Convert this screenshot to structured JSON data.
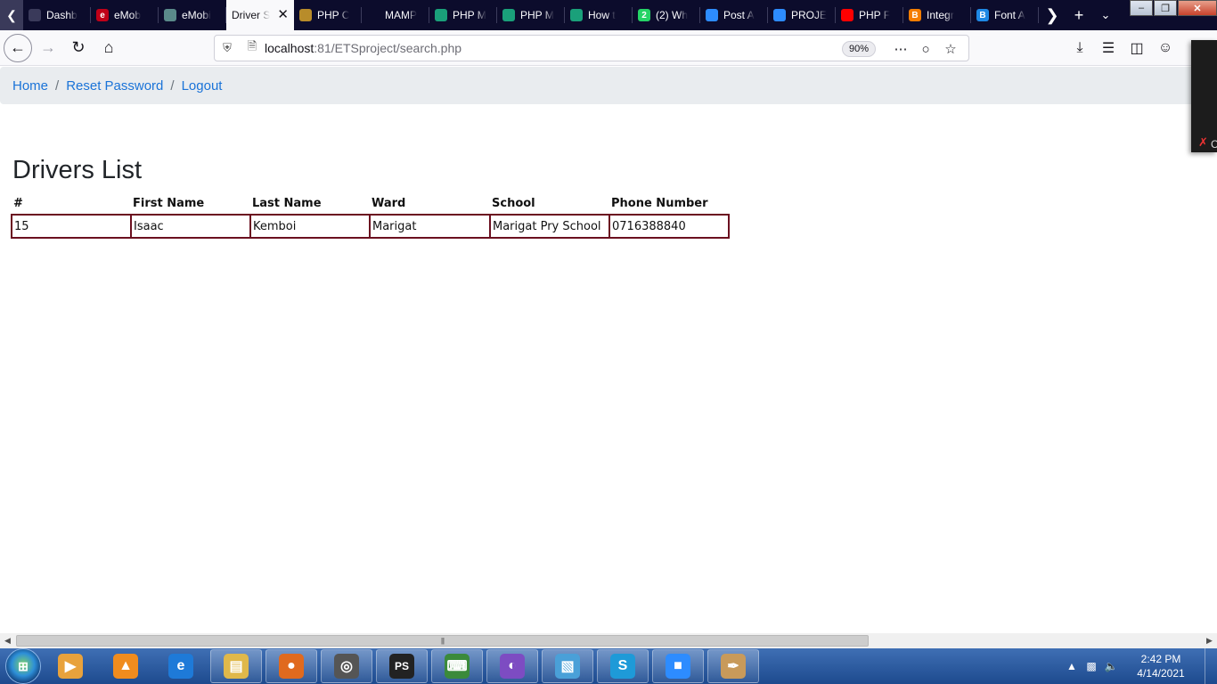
{
  "browser": {
    "tabs": [
      {
        "label": "Dashb",
        "icon": "dashboard-icon",
        "color": "#3a3a5a",
        "glyph": ""
      },
      {
        "label": "eMob",
        "icon": "emobilis-icon",
        "color": "#c00018",
        "glyph": "e"
      },
      {
        "label": "eMobi",
        "icon": "emobilis-alt-icon",
        "color": "#5a8a8a",
        "glyph": ""
      },
      {
        "label": "Driver S",
        "icon": "page-icon",
        "color": "#f9f9fb",
        "glyph": "",
        "active": true
      },
      {
        "label": "PHP C",
        "icon": "php-icon",
        "color": "#b88c2a",
        "glyph": ""
      },
      {
        "label": "MAMP",
        "icon": "mamp-icon",
        "color": "#0c0c2c",
        "glyph": ""
      },
      {
        "label": "PHP M",
        "icon": "udemy-icon",
        "color": "#1aa07a",
        "glyph": ""
      },
      {
        "label": "PHP M",
        "icon": "udemy-icon",
        "color": "#1aa07a",
        "glyph": ""
      },
      {
        "label": "How t",
        "icon": "udemy-icon",
        "color": "#1aa07a",
        "glyph": ""
      },
      {
        "label": "(2) Wh",
        "icon": "whatsapp-icon",
        "color": "#25d366",
        "glyph": "2"
      },
      {
        "label": "Post A",
        "icon": "zoom-icon",
        "color": "#2d8cff",
        "glyph": ""
      },
      {
        "label": "PROJE",
        "icon": "zoom-icon",
        "color": "#2d8cff",
        "glyph": ""
      },
      {
        "label": "PHP F",
        "icon": "youtube-icon",
        "color": "#ff0000",
        "glyph": ""
      },
      {
        "label": "Integr",
        "icon": "blogger-icon",
        "color": "#f57d00",
        "glyph": "B"
      },
      {
        "label": "Font A",
        "icon": "bootstrap-icon",
        "color": "#1e88e5",
        "glyph": "B"
      }
    ],
    "url_host": "localhost",
    "url_rest": ":81/ETSproject/search.php",
    "zoom_level": "90%"
  },
  "breadcrumb": {
    "items": [
      {
        "label": "Home"
      },
      {
        "label": "Reset Password"
      },
      {
        "label": "Logout"
      }
    ],
    "separator": "/"
  },
  "page": {
    "title": "Drivers List"
  },
  "table": {
    "headers": [
      "#",
      "First Name",
      "Last Name",
      "Ward",
      "School",
      "Phone Number"
    ],
    "rows": [
      [
        "15",
        "Isaac",
        "Kemboi",
        "Marigat",
        "Marigat Pry School",
        "0716388840"
      ]
    ]
  },
  "overlay": {
    "text": "C"
  },
  "taskbar": {
    "apps": [
      "media-player-icon",
      "vlc-icon",
      "internet-explorer-icon",
      "file-explorer-icon",
      "firefox-icon",
      "app-icon",
      "phpstorm-icon",
      "terminal-icon",
      "tor-icon",
      "notepad-icon",
      "skype-icon",
      "zoom-icon",
      "paint-icon"
    ],
    "time": "2:42 PM",
    "date": "4/14/2021"
  },
  "colors": {
    "accent_link": "#1a73d8",
    "table_border": "#6b1020",
    "breadcrumb_bg": "#e9ecef"
  }
}
